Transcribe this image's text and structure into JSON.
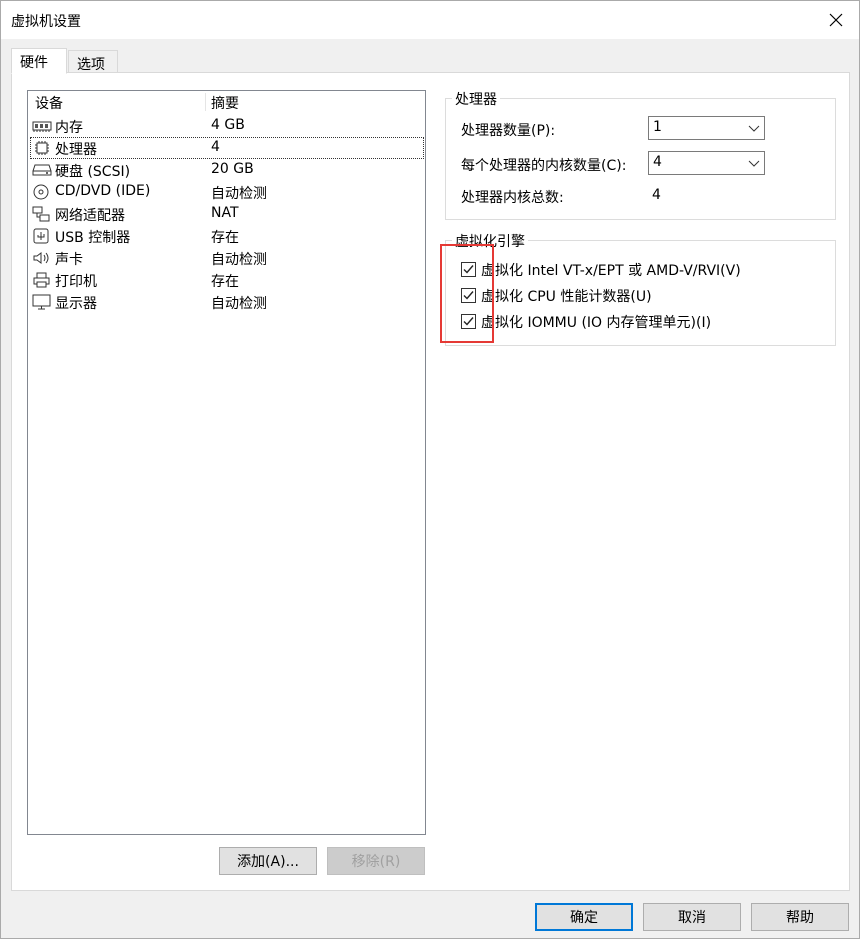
{
  "window": {
    "title": "虚拟机设置"
  },
  "tabs": [
    {
      "label": "硬件"
    },
    {
      "label": "选项"
    }
  ],
  "device_list": {
    "col_device": "设备",
    "col_summary": "摘要",
    "rows": [
      {
        "icon": "memory-icon",
        "name": "内存",
        "value": "4 GB"
      },
      {
        "icon": "processor-icon",
        "name": "处理器",
        "value": "4"
      },
      {
        "icon": "harddisk-icon",
        "name": "硬盘 (SCSI)",
        "value": "20 GB"
      },
      {
        "icon": "cdrom-icon",
        "name": "CD/DVD (IDE)",
        "value": "自动检测"
      },
      {
        "icon": "network-icon",
        "name": "网络适配器",
        "value": "NAT"
      },
      {
        "icon": "usb-icon",
        "name": "USB 控制器",
        "value": "存在"
      },
      {
        "icon": "sound-icon",
        "name": "声卡",
        "value": "自动检测"
      },
      {
        "icon": "printer-icon",
        "name": "打印机",
        "value": "存在"
      },
      {
        "icon": "monitor-icon",
        "name": "显示器",
        "value": "自动检测"
      }
    ]
  },
  "buttons": {
    "add": "添加(A)...",
    "remove": "移除(R)",
    "ok": "确定",
    "cancel": "取消",
    "help": "帮助"
  },
  "processor": {
    "group_title": "处理器",
    "count_label": "处理器数量(P):",
    "count_value": "1",
    "cores_label": "每个处理器的内核数量(C):",
    "cores_value": "4",
    "total_label": "处理器内核总数:",
    "total_value": "4"
  },
  "virtualization": {
    "group_title": "虚拟化引擎",
    "options": [
      {
        "label": "虚拟化 Intel VT-x/EPT 或 AMD-V/RVI(V)",
        "checked": true
      },
      {
        "label": "虚拟化 CPU 性能计数器(U)",
        "checked": true
      },
      {
        "label": "虚拟化 IOMMU (IO 内存管理单元)(I)",
        "checked": true
      }
    ]
  },
  "colors": {
    "highlight": "#e53935",
    "focus": "#0078d7"
  }
}
